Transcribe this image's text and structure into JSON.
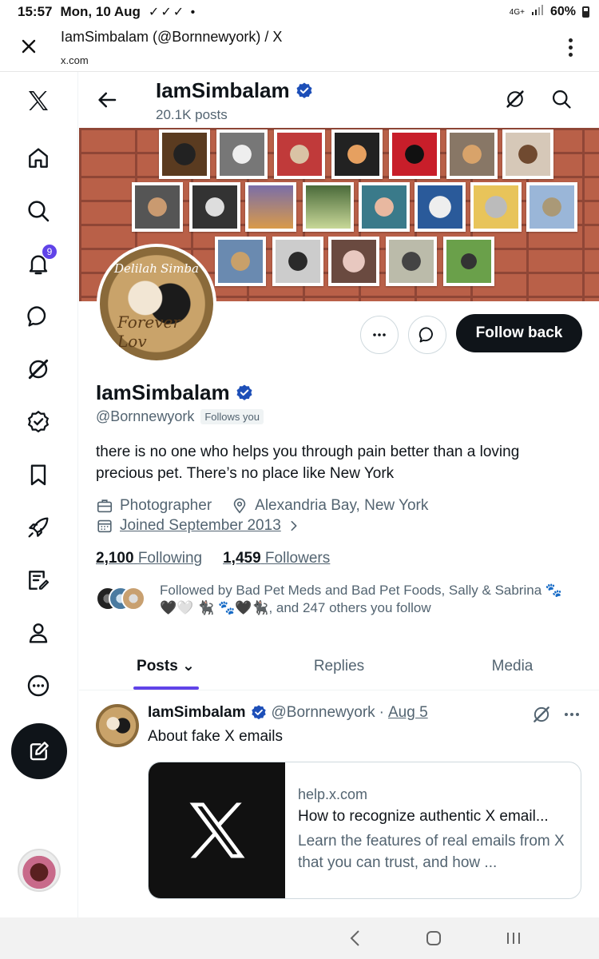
{
  "status_bar": {
    "time": "15:57",
    "date": "Mon, 10 Aug",
    "checks": "✓✓✓ •",
    "network": "4G+",
    "battery": "60%"
  },
  "browser": {
    "title": "IamSimbalam (@Bornnewyork) / X",
    "url": "x.com"
  },
  "nav": {
    "notification_count": "9",
    "items": [
      "home-icon",
      "search-icon",
      "notifications-icon",
      "messages-icon",
      "grok-icon",
      "verified-icon",
      "bookmarks-icon",
      "rocket-icon",
      "lists-icon",
      "profile-icon",
      "more-icon"
    ]
  },
  "header": {
    "name": "IamSimbalam",
    "post_count": "20.1K posts"
  },
  "profile": {
    "avatar_caption_left": "Delilah",
    "avatar_caption_right": "Simba",
    "avatar_caption_bottom": "Forever Lov",
    "follow_button": "Follow back",
    "display_name": "IamSimbalam",
    "handle": "@Bornnewyork",
    "follows_you": "Follows you",
    "bio": "there is no one who helps you through pain better than a loving precious pet. There’s no place like New York",
    "profession": "Photographer",
    "location": "Alexandria Bay, New York",
    "joined": "Joined September 2013",
    "following_count": "2,100",
    "following_label": "Following",
    "followers_count": "1,459",
    "followers_label": "Followers",
    "followed_by": "Followed by Bad Pet Meds and Bad Pet Foods, Sally & Sabrina 🐾🖤🤍 🐈‍⬛ 🐾🖤🐈‍⬛, and 247 others you follow"
  },
  "tabs": [
    {
      "label": "Posts ⌄"
    },
    {
      "label": "Replies"
    },
    {
      "label": "Media"
    }
  ],
  "post": {
    "name": "IamSimbalam",
    "handle": "@Bornnewyork",
    "separator": "·",
    "date": "Aug 5",
    "text": "About fake X emails",
    "card": {
      "domain": "help.x.com",
      "title": "How to recognize authentic X email...",
      "description": "Learn the features of real emails from X that you can trust, and how ..."
    }
  },
  "colors": {
    "accent": "#6043e8",
    "verified": "#1d9bf0",
    "brick": "#b96048"
  }
}
